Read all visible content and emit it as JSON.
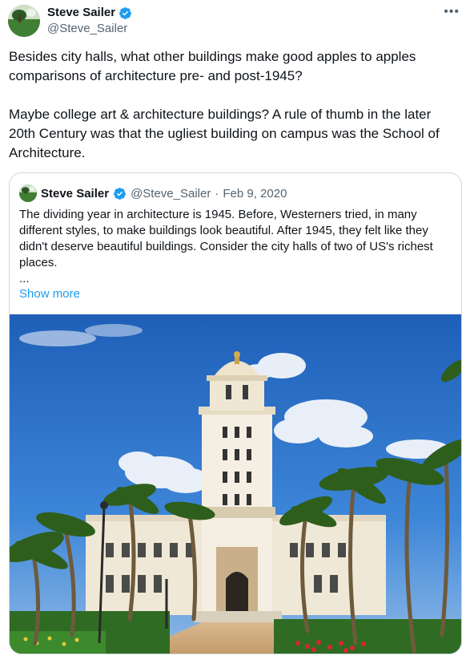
{
  "tweet": {
    "author_name": "Steve Sailer",
    "author_handle": "@Steve_Sailer",
    "more_icon": "•••",
    "paragraphs": [
      "Besides city halls, what other buildings make good apples to apples comparisons of architecture pre- and post-1945?",
      "Maybe college art & architecture buildings? A rule of thumb in the later 20th Century was that the ugliest building on campus was the School of Architecture."
    ]
  },
  "quoted": {
    "author_name": "Steve Sailer",
    "author_handle": "@Steve_Sailer",
    "separator": "·",
    "date": "Feb 9, 2020",
    "text": "The dividing year in architecture is 1945. Before, Westerners tried, in many different styles, to make buildings look beautiful. After 1945, they felt like they didn't deserve beautiful buildings. Consider the city halls of two of US's richest places.",
    "ellipsis": "...",
    "show_more": "Show more",
    "image": "city-hall-tower-with-palm-trees-photo"
  },
  "colors": {
    "text": "#0f1419",
    "secondary": "#536471",
    "link": "#1d9bf0",
    "verified": "#1d9bf0",
    "border": "#cfd9de"
  }
}
